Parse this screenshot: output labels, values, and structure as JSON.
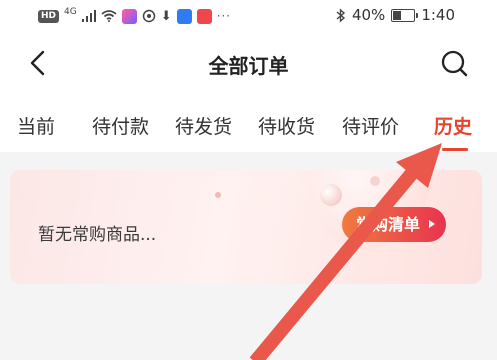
{
  "status_bar": {
    "hd": "HD",
    "network": "4G",
    "battery": "40%",
    "battery_level": 0.4,
    "time": "1:40",
    "more": "···"
  },
  "header": {
    "title": "全部订单"
  },
  "tabs": [
    {
      "label": "当前",
      "active": false
    },
    {
      "label": "待付款",
      "active": false
    },
    {
      "label": "待发货",
      "active": false
    },
    {
      "label": "待收货",
      "active": false
    },
    {
      "label": "待评价",
      "active": false
    },
    {
      "label": "历史",
      "active": true
    }
  ],
  "card": {
    "empty_text": "暂无常购商品...",
    "button_label": "常购清单"
  },
  "colors": {
    "accent": "#e7432e",
    "annotation_arrow": "#e9584a",
    "button_gradient_start": "#f07b3f",
    "button_gradient_end": "#e8334f"
  },
  "icons": {
    "back": "chevron-left-icon",
    "search": "search-icon",
    "annotation": "pointer-arrow-icon"
  }
}
